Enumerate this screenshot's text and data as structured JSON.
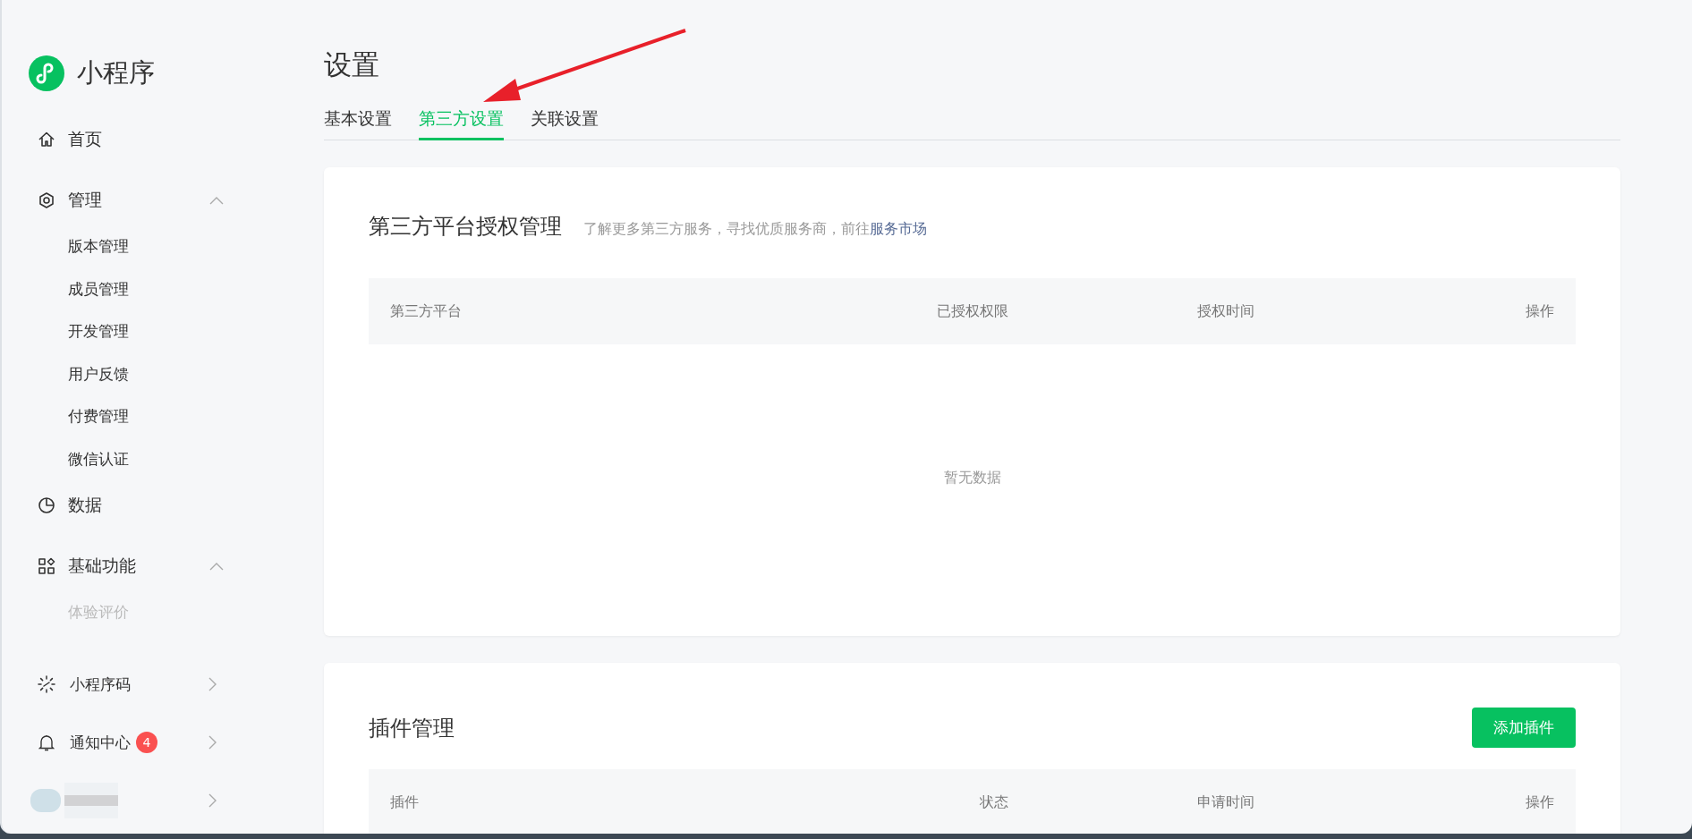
{
  "app": {
    "name": "小程序"
  },
  "sidebar": {
    "items": [
      {
        "kind": "link",
        "label": "首页"
      },
      {
        "kind": "group",
        "label": "管理",
        "expanded": true,
        "children": [
          {
            "label": "版本管理",
            "disabled": false
          },
          {
            "label": "成员管理",
            "disabled": false
          },
          {
            "label": "开发管理",
            "disabled": false
          },
          {
            "label": "用户反馈",
            "disabled": false
          },
          {
            "label": "付费管理",
            "disabled": false
          },
          {
            "label": "微信认证",
            "disabled": false
          }
        ]
      },
      {
        "kind": "link",
        "label": "数据"
      },
      {
        "kind": "group",
        "label": "基础功能",
        "expanded": true,
        "children": [
          {
            "label": "体验评价",
            "disabled": true
          }
        ]
      },
      {
        "kind": "nav",
        "label": "小程序码"
      },
      {
        "kind": "nav",
        "label": "通知中心",
        "badge": "4"
      },
      {
        "kind": "account"
      }
    ]
  },
  "page": {
    "title": "设置",
    "tabs": [
      {
        "label": "基本设置",
        "selected": false
      },
      {
        "label": "第三方设置",
        "selected": true
      },
      {
        "label": "关联设置",
        "selected": false
      }
    ]
  },
  "sections": [
    {
      "title": "第三方平台授权管理",
      "hint": "了解更多第三方服务，寻找优质服务商，前往",
      "hint_link": "服务市场",
      "columns": [
        "第三方平台",
        "已授权权限",
        "授权时间",
        "操作"
      ],
      "empty_text": "暂无数据"
    },
    {
      "title": "插件管理",
      "button": "添加插件",
      "columns": [
        "插件",
        "状态",
        "申请时间",
        "操作"
      ]
    }
  ]
}
